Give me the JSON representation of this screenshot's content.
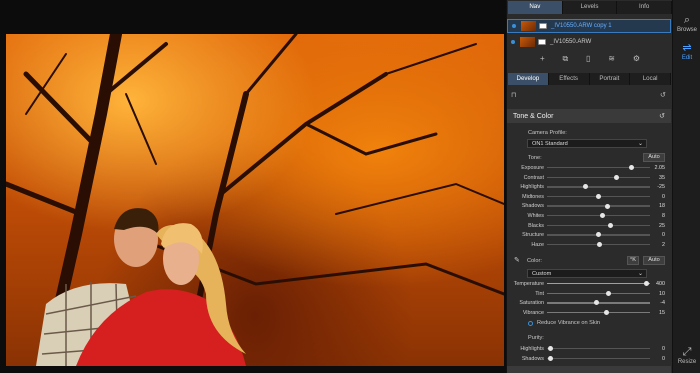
{
  "top_tabs": [
    "Nav",
    "Levels",
    "Info"
  ],
  "layers": [
    {
      "name": "_IV10550.ARW copy 1"
    },
    {
      "name": "_IV10550.ARW"
    }
  ],
  "module_tabs": [
    "Develop",
    "Effects",
    "Portrait",
    "Local"
  ],
  "section_title": "Tone & Color",
  "camera_profile_label": "Camera Profile:",
  "camera_profile_value": "ON1 Standard",
  "tone_label": "Tone:",
  "auto_label": "Auto",
  "tone_sliders": [
    {
      "name": "Exposure",
      "value": "2.05",
      "frac": 0.82
    },
    {
      "name": "Contrast",
      "value": "35",
      "frac": 0.67
    },
    {
      "name": "Highlights",
      "value": "-25",
      "frac": 0.37
    },
    {
      "name": "Midtones",
      "value": "0",
      "frac": 0.5
    },
    {
      "name": "Shadows",
      "value": "18",
      "frac": 0.59
    },
    {
      "name": "Whites",
      "value": "8",
      "frac": 0.54
    },
    {
      "name": "Blacks",
      "value": "25",
      "frac": 0.62
    },
    {
      "name": "Structure",
      "value": "0",
      "frac": 0.5
    },
    {
      "name": "Haze",
      "value": "2",
      "frac": 0.51
    }
  ],
  "color_label": "Color:",
  "kelvin_label": "°K",
  "wb_preset": "Custom",
  "color_sliders": [
    {
      "name": "Temperature",
      "value": "400",
      "frac": 0.97,
      "track": "#c9a02a"
    },
    {
      "name": "Tint",
      "value": "10",
      "frac": 0.6,
      "track": "#9a4aa0"
    },
    {
      "name": "Saturation",
      "value": "-4",
      "frac": 0.48,
      "track": "#7a7a7a"
    },
    {
      "name": "Vibrance",
      "value": "15",
      "frac": 0.58,
      "track": "#7a7a7a"
    }
  ],
  "reduce_vibrance_label": "Reduce Vibrance on Skin",
  "purity_label": "Purity:",
  "purity_sliders": [
    {
      "name": "Highlights",
      "value": "0",
      "frac": 0.03
    },
    {
      "name": "Shadows",
      "value": "0",
      "frac": 0.03
    }
  ],
  "rail": {
    "browse": "Browse",
    "edit": "Edit",
    "resize": "Resize"
  }
}
